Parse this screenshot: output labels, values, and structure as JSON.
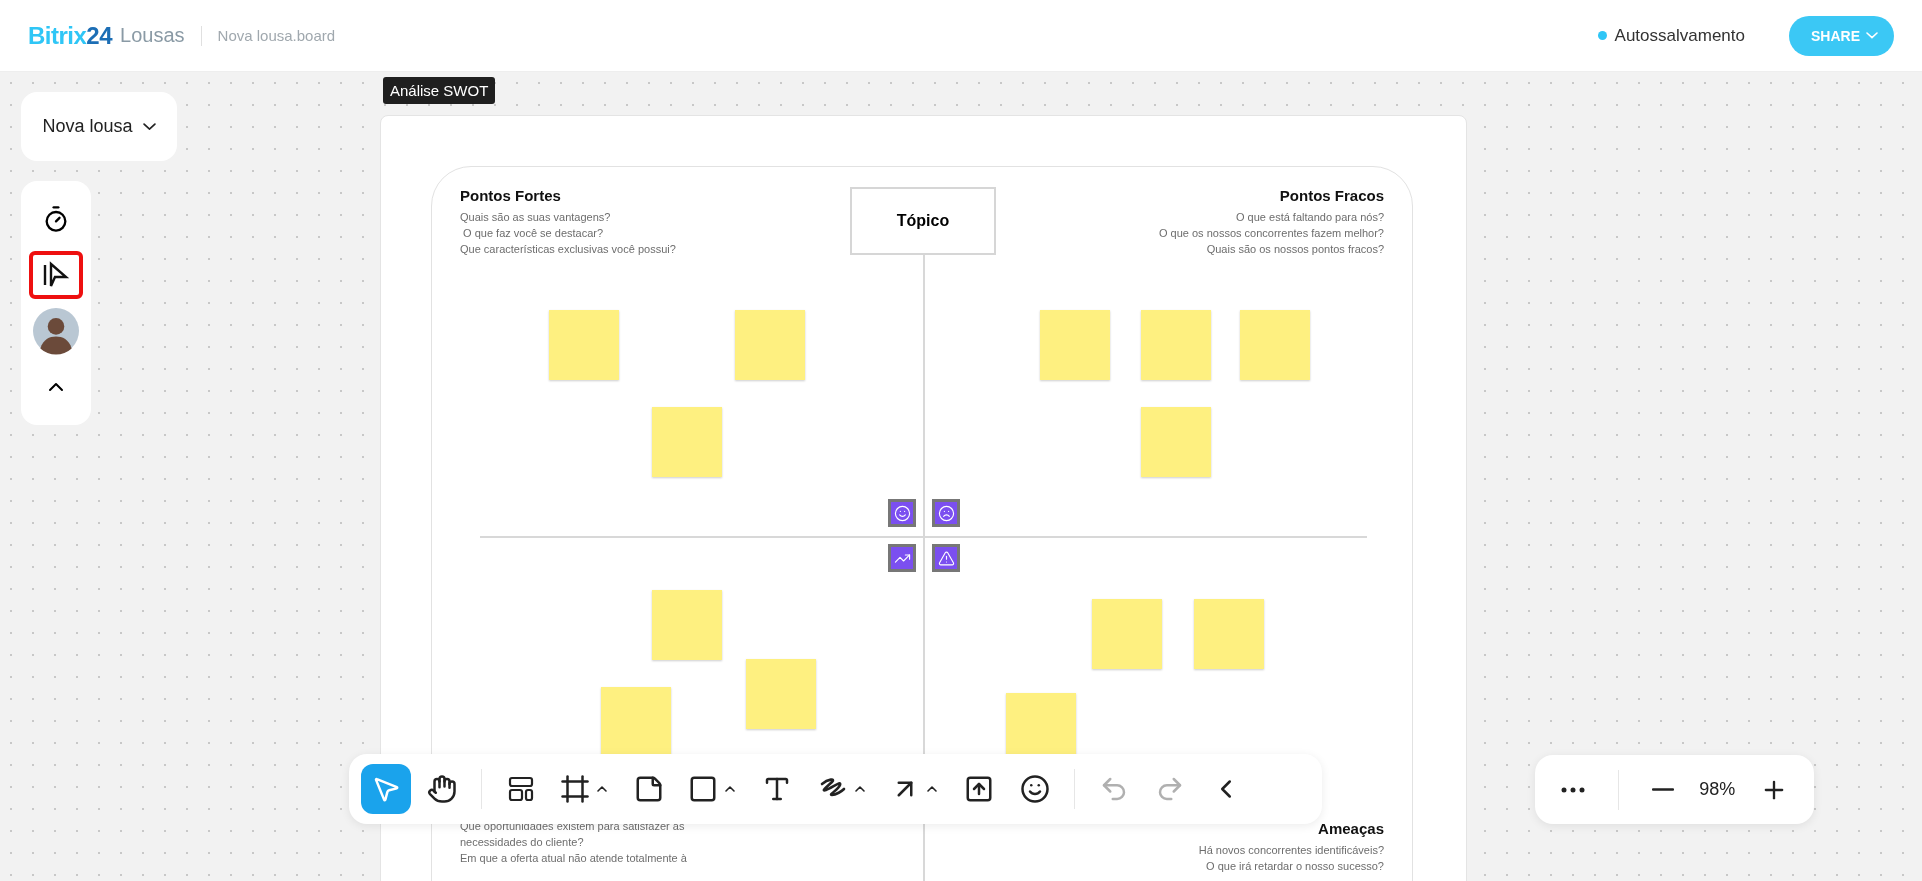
{
  "header": {
    "logo": "Bitrix**24**",
    "product": "Lousas",
    "file_name": "Nova lousa.board",
    "autosave": {
      "label": "Autossalvamento"
    },
    "share_button": "SHARE"
  },
  "sidebar": {
    "board_menu": "Nova lousa",
    "tools": [
      {
        "kind": "timer",
        "highlighted": false
      },
      {
        "kind": "present",
        "highlighted": true
      },
      {
        "kind": "avatar",
        "highlighted": false
      },
      {
        "kind": "collapse",
        "highlighted": false
      }
    ]
  },
  "board": {
    "tag": "Análise SWOT",
    "topic": "Tópico",
    "quadrants": [
      {
        "title": "Pontos Fortes",
        "questions": [
          "Quais são as suas vantagens?",
          " O que faz você se destacar?",
          "Que características exclusivas você possui?"
        ]
      },
      {
        "title": "Pontos Fracos",
        "questions": [
          "O que está faltando para nós?",
          "O que os nossos concorrentes fazem melhor?",
          "Quais são os nossos pontos fracos?"
        ]
      },
      {
        "questions": [
          "Que oportunidades existem para satisfazer as",
          "necessidades do cliente?",
          "Em que a oferta atual não atende totalmente à"
        ]
      },
      {
        "title": "Ameaças",
        "questions": [
          "Há novos concorrentes identificáveis?",
          "O que irá retardar o nosso sucesso?"
        ]
      }
    ]
  },
  "toolbar": {
    "tools": [
      {
        "kind": "select",
        "selected": true,
        "menu": false
      },
      {
        "kind": "hand",
        "selected": false,
        "menu": false
      },
      {
        "kind": "divider"
      },
      {
        "kind": "templates",
        "selected": false,
        "menu": false
      },
      {
        "kind": "frame",
        "selected": false,
        "menu": true
      },
      {
        "kind": "sticky",
        "selected": false,
        "menu": false
      },
      {
        "kind": "shape",
        "selected": false,
        "menu": true
      },
      {
        "kind": "text",
        "selected": false,
        "menu": false
      },
      {
        "kind": "pen",
        "selected": false,
        "menu": true
      },
      {
        "kind": "arrow",
        "selected": false,
        "menu": true
      },
      {
        "kind": "upload",
        "selected": false,
        "menu": false
      },
      {
        "kind": "emoji",
        "selected": false,
        "menu": false
      },
      {
        "kind": "divider"
      },
      {
        "kind": "undo",
        "selected": false,
        "menu": false,
        "disabled": true
      },
      {
        "kind": "redo",
        "selected": false,
        "menu": false,
        "disabled": true
      },
      {
        "kind": "collapse",
        "selected": false,
        "menu": false
      }
    ]
  },
  "zoom": {
    "value": "98%"
  }
}
